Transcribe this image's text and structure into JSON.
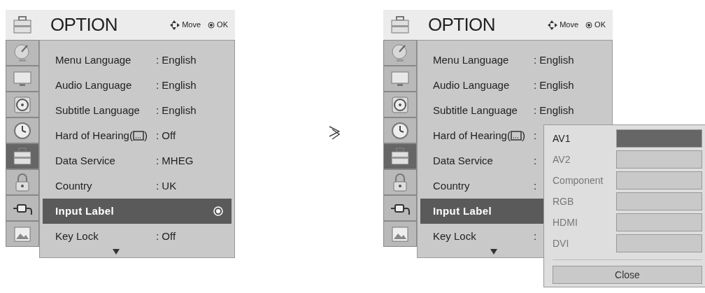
{
  "screens": [
    {
      "title": "OPTION",
      "hints": [
        {
          "kind": "move",
          "label": "Move"
        },
        {
          "kind": "ok",
          "label": "OK"
        }
      ],
      "categories": [
        {
          "kind": "satellite",
          "selected": false
        },
        {
          "kind": "tv",
          "selected": false
        },
        {
          "kind": "speaker",
          "selected": false
        },
        {
          "kind": "clock",
          "selected": false
        },
        {
          "kind": "toolbox",
          "selected": true
        },
        {
          "kind": "lock",
          "selected": false
        },
        {
          "kind": "plug",
          "selected": false
        },
        {
          "kind": "picture",
          "selected": false
        }
      ],
      "items": [
        {
          "label": "Menu Language",
          "value": ": English",
          "selected": false
        },
        {
          "label": "Audio Language",
          "value": ": English",
          "selected": false
        },
        {
          "label": "Subtitle Language",
          "value": ": English",
          "selected": false
        },
        {
          "label": "Hard of Hearing(",
          "label_suffix": ")",
          "value": ": Off",
          "selected": false
        },
        {
          "label": "Data Service",
          "value": ": MHEG",
          "selected": false
        },
        {
          "label": "Country",
          "value": ": UK",
          "selected": false
        },
        {
          "label": "Input Label",
          "selected": true
        },
        {
          "label": "Key Lock",
          "value": ": Off",
          "selected": false
        }
      ]
    },
    {
      "title": "OPTION",
      "hints": [
        {
          "kind": "move",
          "label": "Move"
        },
        {
          "kind": "ok",
          "label": "OK"
        }
      ],
      "categories": [
        {
          "kind": "satellite",
          "selected": false
        },
        {
          "kind": "tv",
          "selected": false
        },
        {
          "kind": "speaker",
          "selected": false
        },
        {
          "kind": "clock",
          "selected": false
        },
        {
          "kind": "toolbox",
          "selected": true
        },
        {
          "kind": "lock",
          "selected": false
        },
        {
          "kind": "plug",
          "selected": false
        },
        {
          "kind": "picture",
          "selected": false
        }
      ],
      "items": [
        {
          "label": "Menu Language",
          "value": ": English",
          "selected": false
        },
        {
          "label": "Audio Language",
          "value": ": English",
          "selected": false
        },
        {
          "label": "Subtitle Language",
          "value": ": English",
          "selected": false
        },
        {
          "label": "Hard of Hearing(",
          "label_suffix": ")",
          "value": ":",
          "selected": false
        },
        {
          "label": "Data Service",
          "value": ":",
          "selected": false
        },
        {
          "label": "Country",
          "value": ":",
          "selected": false
        },
        {
          "label": "Input Label",
          "selected": true
        },
        {
          "label": "Key Lock",
          "value": ":",
          "selected": false
        }
      ],
      "popup": {
        "options": [
          {
            "label": "AV1",
            "selected": true
          },
          {
            "label": "AV2",
            "selected": false
          },
          {
            "label": "Component",
            "selected": false
          },
          {
            "label": "RGB",
            "selected": false
          },
          {
            "label": "HDMI",
            "selected": false
          },
          {
            "label": "DVI",
            "selected": false
          }
        ],
        "close": "Close"
      }
    }
  ]
}
